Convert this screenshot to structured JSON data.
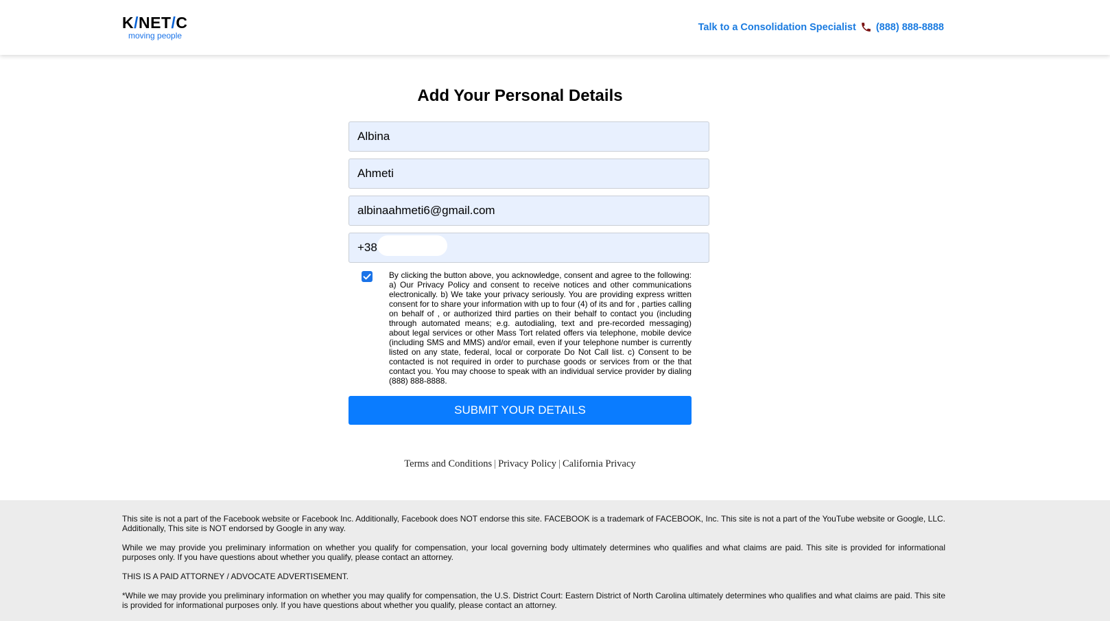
{
  "header": {
    "logo": {
      "name_part1": "K",
      "slash1": "/",
      "name_part2": "NET",
      "slash2": "/",
      "name_part3": "C",
      "tagline": "moving people"
    },
    "contact_label": "Talk to a Consolidation Specialist",
    "phone_icon": "phone-icon",
    "phone": "(888) 888-8888",
    "accent_color": "#1a7be0"
  },
  "form": {
    "title": "Add Your Personal Details",
    "first_name": "Albina",
    "last_name": "Ahmeti",
    "email": "albinaahmeti6@gmail.com",
    "phone_prefix": "+38",
    "consent_checked": true,
    "consent_text": "By clicking the button above, you acknowledge, consent and agree to the following: a) Our Privacy Policy and consent to receive notices and other communications electronically. b) We take your privacy seriously. You are providing express written consent for to share your information with up to four (4) of its and for , parties calling on behalf of , or authorized third parties on their behalf to contact you (including through automated means; e.g. autodialing, text and pre-recorded messaging) about legal services or other Mass Tort related offers via telephone, mobile device (including SMS and MMS) and/or email, even if your telephone number is currently listed on any state, federal, local or corporate Do Not Call list. c) Consent to be contacted is not required in order to purchase goods or services from or the that contact you. You may choose to speak with an individual service provider by dialing (888) 888-8888.",
    "submit_label": "SUBMIT YOUR DETAILS",
    "submit_color": "#0a7cff"
  },
  "links": {
    "terms": "Terms and Conditions",
    "separator": "|",
    "privacy": "Privacy Policy",
    "california": "California Privacy"
  },
  "footer": {
    "p1": "This site is not a part of the Facebook website or Facebook Inc. Additionally, Facebook does NOT endorse this site. FACEBOOK is a trademark of FACEBOOK, Inc. This site is not a part of the YouTube website or Google, LLC. Additionally, This site is NOT endorsed by Google in any way.",
    "p2": "While we may provide you preliminary information on whether you qualify for compensation, your local governing body ultimately determines who qualifies and what claims are paid. This site is provided for informational purposes only. If you have questions about whether you qualify, please contact an attorney.",
    "p3": "THIS IS A PAID ATTORNEY / ADVOCATE ADVERTISEMENT.",
    "p4": "*While we may provide you preliminary information on whether you may qualify for compensation, the U.S. District Court: Eastern District of North Carolina ultimately determines who qualifies and what claims are paid. This site is provided for informational purposes only. If you have questions about whether you qualify, please contact an attorney.",
    "background": "#ececec"
  }
}
